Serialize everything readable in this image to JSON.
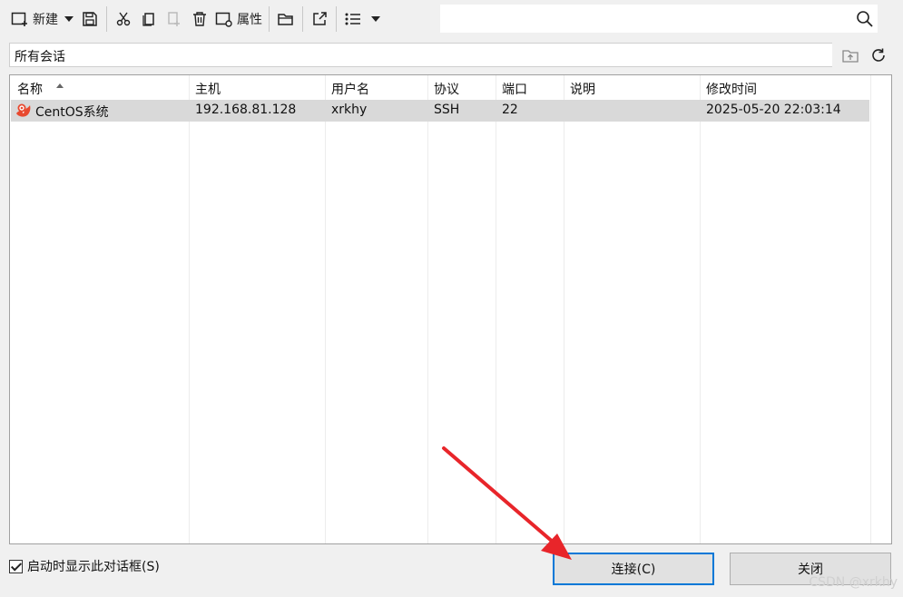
{
  "toolbar": {
    "new_label": "新建",
    "properties_label": "属性"
  },
  "search": {
    "value": "",
    "placeholder": ""
  },
  "pathbar": {
    "text": "所有会话"
  },
  "table": {
    "columns": [
      "名称",
      "主机",
      "用户名",
      "协议",
      "端口",
      "说明",
      "修改时间"
    ],
    "rows": [
      {
        "name": "CentOS系统",
        "host": "192.168.81.128",
        "user": "xrkhy",
        "protocol": "SSH",
        "port": "22",
        "desc": "",
        "modified": "2025-05-20 22:03:14"
      }
    ]
  },
  "footer": {
    "startup_checkbox_label": "启动时显示此对话框(S)",
    "startup_checked": true,
    "connect_label": "连接(C)",
    "close_label": "关闭"
  },
  "watermark": "CSDN @xrkhy",
  "colors": {
    "accent": "#0078d7",
    "annotation_arrow": "#e8252a",
    "session_icon": "#e8492f",
    "selected_row": "#d9d9d9"
  },
  "icons": [
    "new-session-icon",
    "dropdown-icon",
    "save-icon",
    "cut-icon",
    "copy-icon",
    "paste-icon",
    "delete-icon",
    "properties-icon",
    "open-folder-icon",
    "export-icon",
    "list-view-icon",
    "search-icon",
    "folder-up-icon",
    "refresh-icon",
    "session-icon"
  ]
}
